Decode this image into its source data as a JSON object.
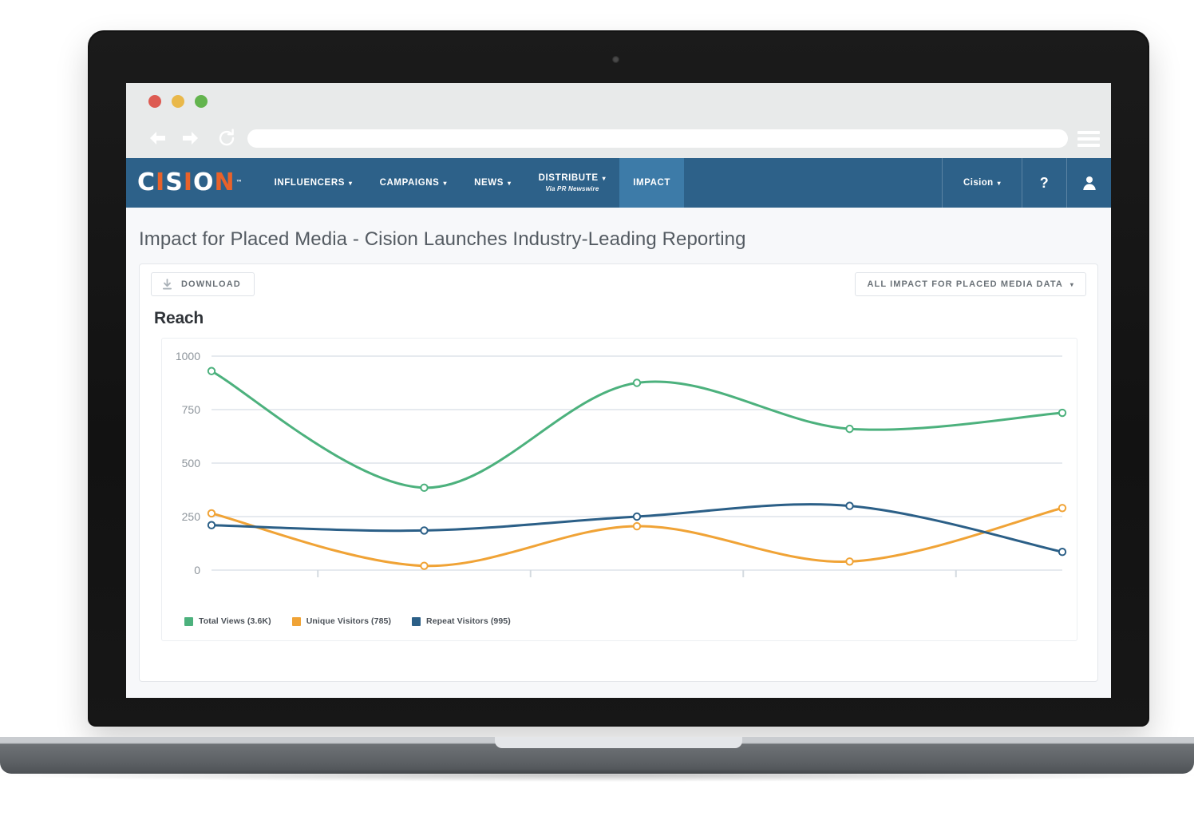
{
  "browser": {
    "traffic_lights": [
      "close",
      "minimize",
      "zoom"
    ],
    "url_value": "",
    "url_placeholder": "",
    "back_icon": "back-arrow-icon",
    "forward_icon": "forward-arrow-icon",
    "reload_icon": "reload-icon",
    "menu_icon": "hamburger-menu-icon"
  },
  "appnav": {
    "logo_parts": [
      "C",
      "I",
      "S",
      "I",
      "O",
      "N"
    ],
    "logo_text": "CISION",
    "logo_tm": "™",
    "items": [
      {
        "label": "INFLUENCERS",
        "caret": "▾",
        "sub": "",
        "active": false
      },
      {
        "label": "CAMPAIGNS",
        "caret": "▾",
        "sub": "",
        "active": false
      },
      {
        "label": "NEWS",
        "caret": "▾",
        "sub": "",
        "active": false
      },
      {
        "label": "DISTRIBUTE",
        "caret": "▾",
        "sub": "Via PR Newswire",
        "active": false
      },
      {
        "label": "IMPACT",
        "caret": "",
        "sub": "",
        "active": true
      }
    ],
    "account_label": "Cision",
    "account_caret": "▾",
    "help_label": "?",
    "user_icon": "user-avatar-icon",
    "bg_color": "#2d6189",
    "active_color": "#3d7ba8"
  },
  "page": {
    "title": "Impact for Placed Media - Cision Launches Industry-Leading Reporting"
  },
  "toolbar": {
    "download_label": "DOWNLOAD",
    "download_icon": "download-icon",
    "filter_label": "ALL IMPACT FOR PLACED MEDIA DATA",
    "filter_caret": "▾"
  },
  "section": {
    "title": "Reach"
  },
  "chart_data": {
    "type": "line",
    "title": "Reach",
    "xlabel": "",
    "ylabel": "",
    "x": [
      1,
      2,
      3,
      4,
      5
    ],
    "xtick_labels": [
      "",
      "",
      "",
      "",
      ""
    ],
    "ytick_labels": [
      "0",
      "250",
      "500",
      "750",
      "1000"
    ],
    "yticks": [
      0,
      250,
      500,
      750,
      1000
    ],
    "ylim": [
      0,
      1000
    ],
    "grid": true,
    "legend_position": "bottom-left",
    "smoothing": "spline",
    "markers": "open-circle",
    "series": [
      {
        "name": "Total Views",
        "total": "3.6K",
        "legend": "Total Views (3.6K)",
        "color": "#4cb17d",
        "values": [
          930,
          385,
          875,
          660,
          735
        ]
      },
      {
        "name": "Unique Visitors",
        "total": "785",
        "legend": "Unique Visitors (785)",
        "color": "#f0a336",
        "values": [
          265,
          20,
          205,
          40,
          290
        ]
      },
      {
        "name": "Repeat Visitors",
        "total": "995",
        "legend": "Repeat Visitors (995)",
        "color": "#2b5f87",
        "values": [
          210,
          185,
          250,
          300,
          85
        ]
      }
    ]
  }
}
